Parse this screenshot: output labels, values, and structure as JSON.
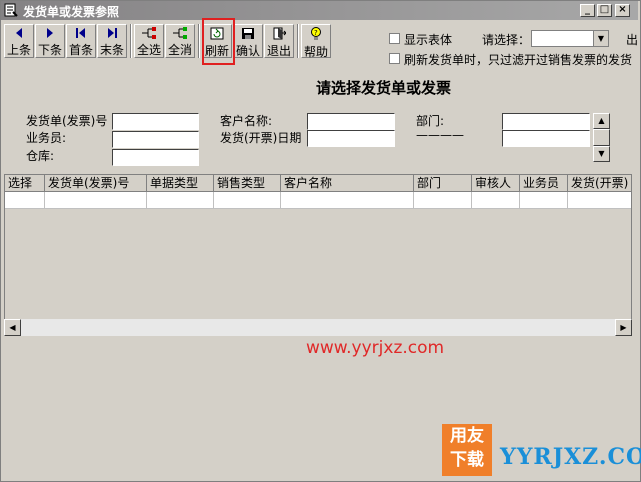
{
  "window": {
    "title": "发货单或发票参照"
  },
  "toolbar": {
    "prev": "上条",
    "next": "下条",
    "first": "首条",
    "last": "末条",
    "select_all": "全选",
    "select_none": "全消",
    "refresh": "刷新",
    "confirm": "确认",
    "exit": "退出",
    "help": "帮助"
  },
  "options": {
    "show_table": "显示表体",
    "choose_label": "请选择：",
    "choose_value": "",
    "right_clip": "出",
    "refresh_filter": "刷新发货单时，只过滤开过销售发票的发货"
  },
  "heading": "请选择发货单或发票",
  "filters": {
    "invoice_no": {
      "label": "发货单(发票)号",
      "value": ""
    },
    "salesperson": {
      "label": "业务员:",
      "value": ""
    },
    "warehouse": {
      "label": "仓库:",
      "value": ""
    },
    "customer": {
      "label": "客户名称:",
      "value": ""
    },
    "date": {
      "label": "发货(开票)日期",
      "value": ""
    },
    "dept": {
      "label": "部门:",
      "dash": "————",
      "value": "",
      "value2": ""
    }
  },
  "grid": {
    "columns": [
      "选择",
      "发货单(发票)号",
      "单据类型",
      "销售类型",
      "客户名称",
      "部门",
      "审核人",
      "业务员",
      "发货(开票)"
    ]
  },
  "watermark": {
    "url": "www.yyrjxz.com",
    "logo_top": "用友",
    "logo_bottom": "下载",
    "domain": "YYRJXZ.COM"
  },
  "colors": {
    "highlight": "#e02020",
    "watermark_red": "#e02828",
    "watermark_blue": "#1a8fd8",
    "logo_orange": "#f07f2a"
  }
}
